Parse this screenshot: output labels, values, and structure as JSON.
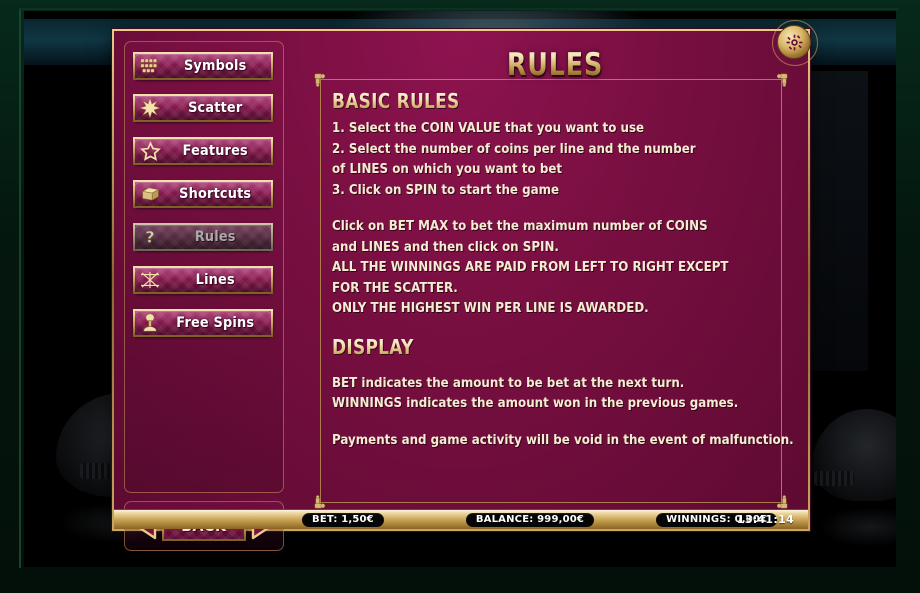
{
  "sidebar": {
    "items": [
      {
        "label": "Symbols",
        "icon": "coins-grid-icon",
        "active": false
      },
      {
        "label": "Scatter",
        "icon": "starburst-icon",
        "active": false
      },
      {
        "label": "Features",
        "icon": "star-outline-icon",
        "active": false
      },
      {
        "label": "Shortcuts",
        "icon": "box-icon",
        "active": false
      },
      {
        "label": "Rules",
        "icon": "question-mark-icon",
        "active": true
      },
      {
        "label": "Lines",
        "icon": "crossed-lines-icon",
        "active": false
      },
      {
        "label": "Free Spins",
        "icon": "joystick-icon",
        "active": false
      }
    ],
    "back_label": "BACK",
    "prev_icon": "left-arrow-icon",
    "next_icon": "right-arrow-icon"
  },
  "header": {
    "title": "RULES",
    "settings_icon": "gear-icon"
  },
  "content": {
    "basic_rules_heading": "BASIC RULES",
    "basic_rules_lines": [
      "1. Select the COIN VALUE that you want to use",
      "2. Select the number of coins per line and the number",
      "of LINES on which you want to bet",
      "3. Click on SPIN to start the game"
    ],
    "bet_max_lines": [
      "Click on BET MAX to bet the maximum number of COINS",
      "and LINES and then click on SPIN.",
      "ALL THE WINNINGS ARE PAID FROM LEFT TO RIGHT EXCEPT",
      "FOR THE SCATTER.",
      "ONLY THE HIGHEST WIN PER LINE IS AWARDED."
    ],
    "display_heading": "DISPLAY",
    "display_lines": [
      "BET indicates the amount to be bet at the next turn.",
      "WINNINGS indicates the amount won in the previous games."
    ],
    "malfunction_line": "Payments and game activity will be void in the event of malfunction."
  },
  "status": {
    "bet": "BET: 1,50€",
    "balance": "BALANCE: 999,00€",
    "winnings": "WINNINGS: 0,00€",
    "time": "13:41:14"
  },
  "colors": {
    "panel_magenta": "#7a0f42",
    "gold": "#d8b878",
    "text_cream": "#f6ecd2",
    "frame_green": "#06291b"
  }
}
